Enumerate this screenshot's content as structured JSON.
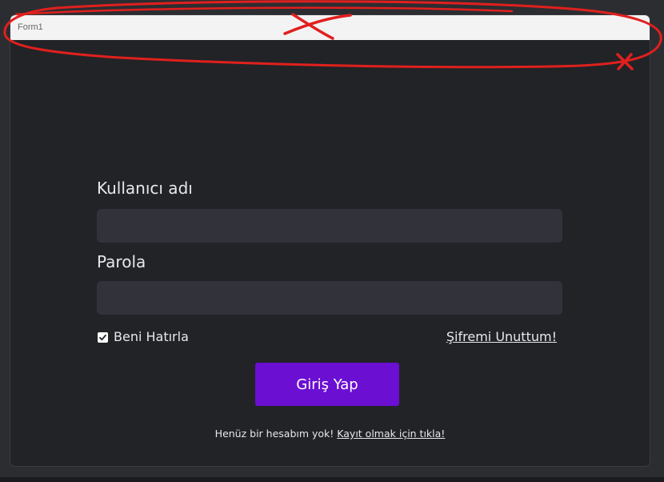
{
  "window": {
    "title": "Form1"
  },
  "login": {
    "username_label": "Kullanıcı adı",
    "username_value": "",
    "password_label": "Parola",
    "password_value": "",
    "remember_label": "Beni Hatırla",
    "remember_checked": true,
    "forgot_link": "Şifremi Unuttum!",
    "submit_label": "Giriş Yap",
    "no_account_text": "Henüz bir hesabım yok!",
    "register_link": "Kayıt olmak için tıkla!"
  },
  "colors": {
    "background": "#222327",
    "field": "#31323a",
    "accent": "#6b0fd2",
    "annotation": "#e0201e"
  }
}
